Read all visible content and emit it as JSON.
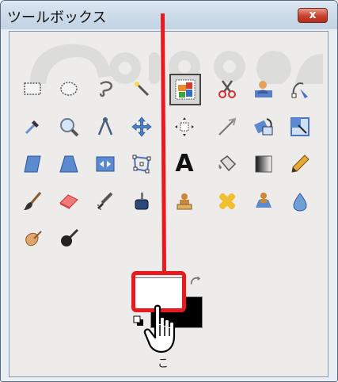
{
  "window": {
    "title": "ツールボックス",
    "close_label": "x"
  },
  "tools": [
    {
      "icon": "rect-select-icon",
      "row": 0,
      "col": 0
    },
    {
      "icon": "ellipse-select-icon",
      "row": 0,
      "col": 1
    },
    {
      "icon": "free-select-icon",
      "row": 0,
      "col": 2
    },
    {
      "icon": "fuzzy-select-icon",
      "row": 0,
      "col": 3
    },
    {
      "icon": "select-by-color-icon",
      "row": 0,
      "col": 4,
      "selected": true
    },
    {
      "icon": "scissors-select-icon",
      "row": 0,
      "col": 5
    },
    {
      "icon": "foreground-select-icon",
      "row": 0,
      "col": 6
    },
    {
      "icon": "paths-icon",
      "row": 0,
      "col": 7
    },
    {
      "icon": "color-picker-icon",
      "row": 1,
      "col": 0
    },
    {
      "icon": "zoom-icon",
      "row": 1,
      "col": 1
    },
    {
      "icon": "measure-icon",
      "row": 1,
      "col": 2
    },
    {
      "icon": "move-icon",
      "row": 1,
      "col": 3
    },
    {
      "icon": "align-icon",
      "row": 1,
      "col": 4
    },
    {
      "icon": "crop-icon",
      "row": 1,
      "col": 5
    },
    {
      "icon": "rotate-icon",
      "row": 1,
      "col": 6
    },
    {
      "icon": "scale-icon",
      "row": 1,
      "col": 7
    },
    {
      "icon": "shear-icon",
      "row": 2,
      "col": 0
    },
    {
      "icon": "perspective-icon",
      "row": 2,
      "col": 1
    },
    {
      "icon": "flip-icon",
      "row": 2,
      "col": 2
    },
    {
      "icon": "cage-transform-icon",
      "row": 2,
      "col": 3
    },
    {
      "icon": "text-icon",
      "row": 2,
      "col": 4,
      "glyph": "A"
    },
    {
      "icon": "bucket-fill-icon",
      "row": 2,
      "col": 5
    },
    {
      "icon": "blend-icon",
      "row": 2,
      "col": 6
    },
    {
      "icon": "pencil-icon",
      "row": 2,
      "col": 7
    },
    {
      "icon": "paintbrush-icon",
      "row": 3,
      "col": 0
    },
    {
      "icon": "eraser-icon",
      "row": 3,
      "col": 1
    },
    {
      "icon": "airbrush-icon",
      "row": 3,
      "col": 2
    },
    {
      "icon": "ink-icon",
      "row": 3,
      "col": 3
    },
    {
      "icon": "clone-icon",
      "row": 3,
      "col": 4
    },
    {
      "icon": "heal-icon",
      "row": 3,
      "col": 5
    },
    {
      "icon": "perspective-clone-icon",
      "row": 3,
      "col": 6
    },
    {
      "icon": "blur-sharpen-icon",
      "row": 3,
      "col": 7
    },
    {
      "icon": "smudge-icon",
      "row": 4,
      "col": 0
    },
    {
      "icon": "dodge-burn-icon",
      "row": 4,
      "col": 1
    }
  ],
  "colors": {
    "foreground": "#ffffff",
    "background": "#000000",
    "highlight": "#e8191f"
  },
  "bottom_text": "こ"
}
